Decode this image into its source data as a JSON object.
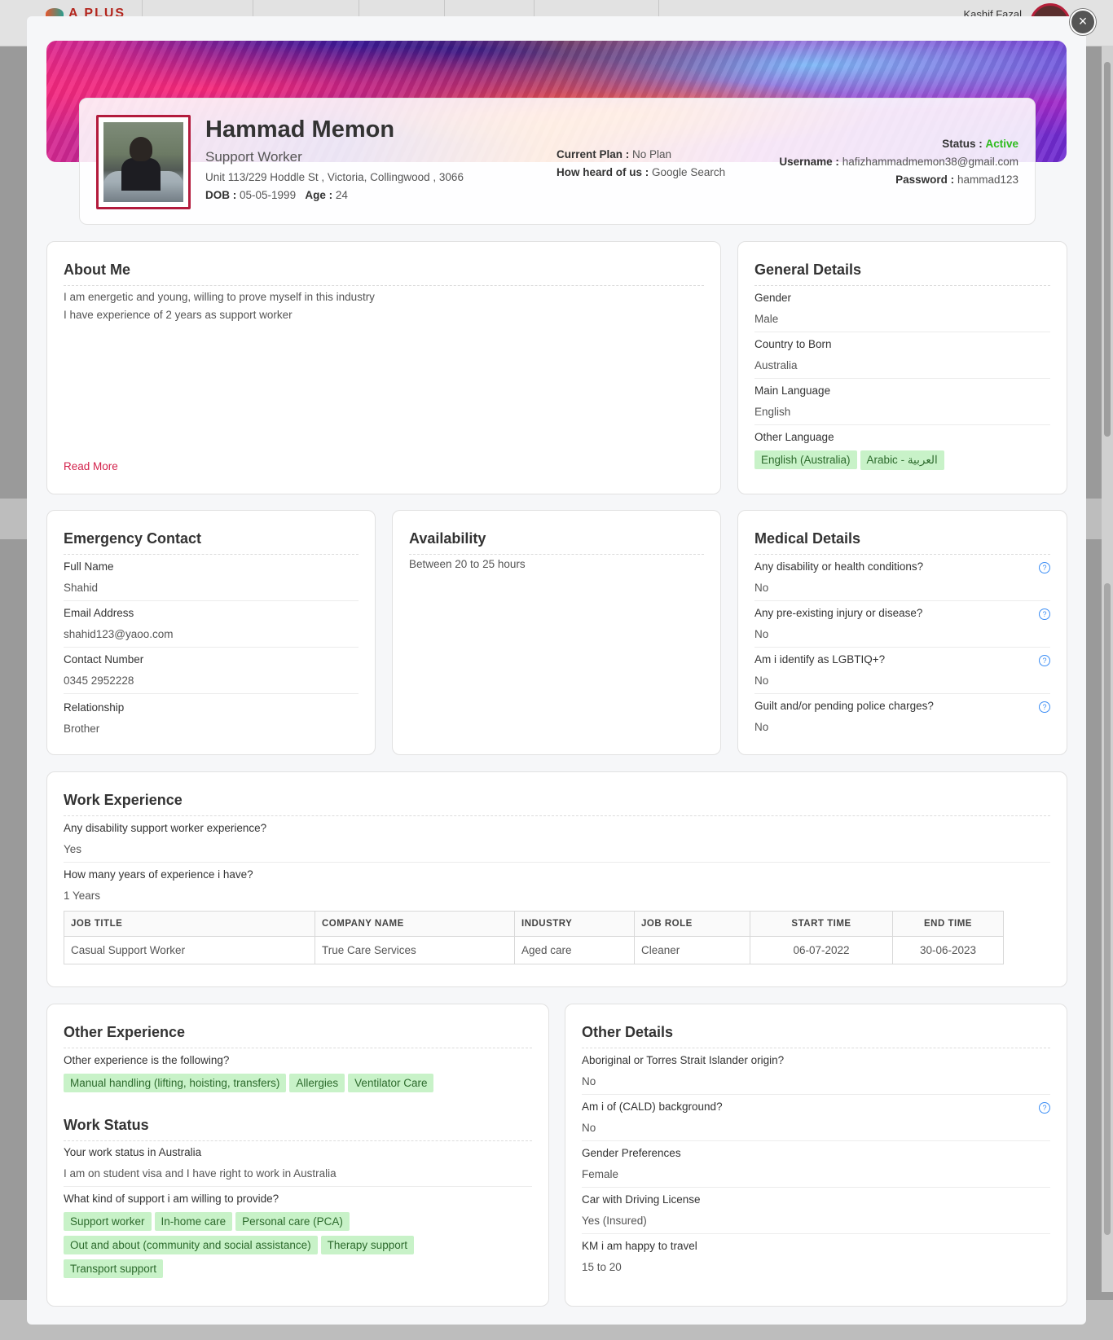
{
  "background": {
    "logo": "A PLUS",
    "user_name": "Kashif Fazal"
  },
  "modal": {
    "close_label": "×"
  },
  "profile": {
    "name": "Hammad Memon",
    "role": "Support Worker",
    "address": "Unit 113/229 Hoddle St , Victoria, Collingwood , 3066",
    "dob_label": "DOB :",
    "dob": "05-05-1999",
    "age_label": "Age :",
    "age": "24",
    "plan_label": "Current Plan :",
    "plan": "No Plan",
    "heard_label": "How heard of us :",
    "heard": "Google Search",
    "status_label": "Status :",
    "status": "Active",
    "username_label": "Username :",
    "username": "hafizhammadmemon38@gmail.com",
    "password_label": "Password :",
    "password": "hammad123"
  },
  "about": {
    "title": "About Me",
    "line1": "I am energetic and young, willing to prove myself in this industry",
    "line2": "I have experience of 2 years as support worker",
    "read_more": "Read More"
  },
  "general": {
    "title": "General Details",
    "gender_label": "Gender",
    "gender": "Male",
    "country_label": "Country to Born",
    "country": "Australia",
    "main_lang_label": "Main Language",
    "main_lang": "English",
    "other_lang_label": "Other Language",
    "other_langs": [
      "English (Australia)",
      "Arabic - العربية"
    ]
  },
  "emergency": {
    "title": "Emergency Contact",
    "name_label": "Full Name",
    "name": "Shahid",
    "email_label": "Email Address",
    "email": "shahid123@yaoo.com",
    "phone_label": "Contact Number",
    "phone": "0345 2952228",
    "relation_label": "Relationship",
    "relation": "Brother"
  },
  "availability": {
    "title": "Availability",
    "value": "Between 20 to 25 hours"
  },
  "medical": {
    "title": "Medical Details",
    "items": [
      {
        "q": "Any disability or health conditions?",
        "a": "No"
      },
      {
        "q": "Any pre-existing injury or disease?",
        "a": "No"
      },
      {
        "q": "Am i identify as LGBTIQ+?",
        "a": "No"
      },
      {
        "q": "Guilt and/or pending police charges?",
        "a": "No"
      }
    ]
  },
  "work_experience": {
    "title": "Work Experience",
    "q1": "Any disability support worker experience?",
    "a1": "Yes",
    "q2": "How many years of experience i have?",
    "a2": "1 Years",
    "columns": [
      "JOB TITLE",
      "COMPANY NAME",
      "INDUSTRY",
      "JOB ROLE",
      "START TIME",
      "END TIME"
    ],
    "rows": [
      [
        "Casual Support Worker",
        "True Care Services",
        "Aged care",
        "Cleaner",
        "06-07-2022",
        "30-06-2023"
      ]
    ]
  },
  "other_experience": {
    "title": "Other Experience",
    "label": "Other experience is the following?",
    "tags": [
      "Manual handling (lifting, hoisting, transfers)",
      "Allergies",
      "Ventilator Care"
    ]
  },
  "work_status": {
    "title": "Work Status",
    "q1": "Your work status in Australia",
    "a1": "I am on student visa and I have right to work in Australia",
    "q2": "What kind of support i am willing to provide?",
    "tags": [
      "Support worker",
      "In-home care",
      "Personal care (PCA)",
      "Out and about (community and social assistance)",
      "Therapy support",
      "Transport support"
    ]
  },
  "other_details": {
    "title": "Other Details",
    "items": [
      {
        "q": "Aboriginal or Torres Strait Islander origin?",
        "a": "No"
      },
      {
        "q": "Am i of (CALD) background?",
        "a": "No"
      },
      {
        "q": "Gender Preferences",
        "a": "Female"
      },
      {
        "q": "Car with Driving License",
        "a": "Yes (Insured)"
      },
      {
        "q": "KM i am happy to travel",
        "a": "15 to 20"
      }
    ]
  },
  "colors": {
    "accent": "#d3224b",
    "active": "#2ebc1d",
    "tag_bg": "#c8f2c8",
    "help_icon": "#3b8df5"
  }
}
